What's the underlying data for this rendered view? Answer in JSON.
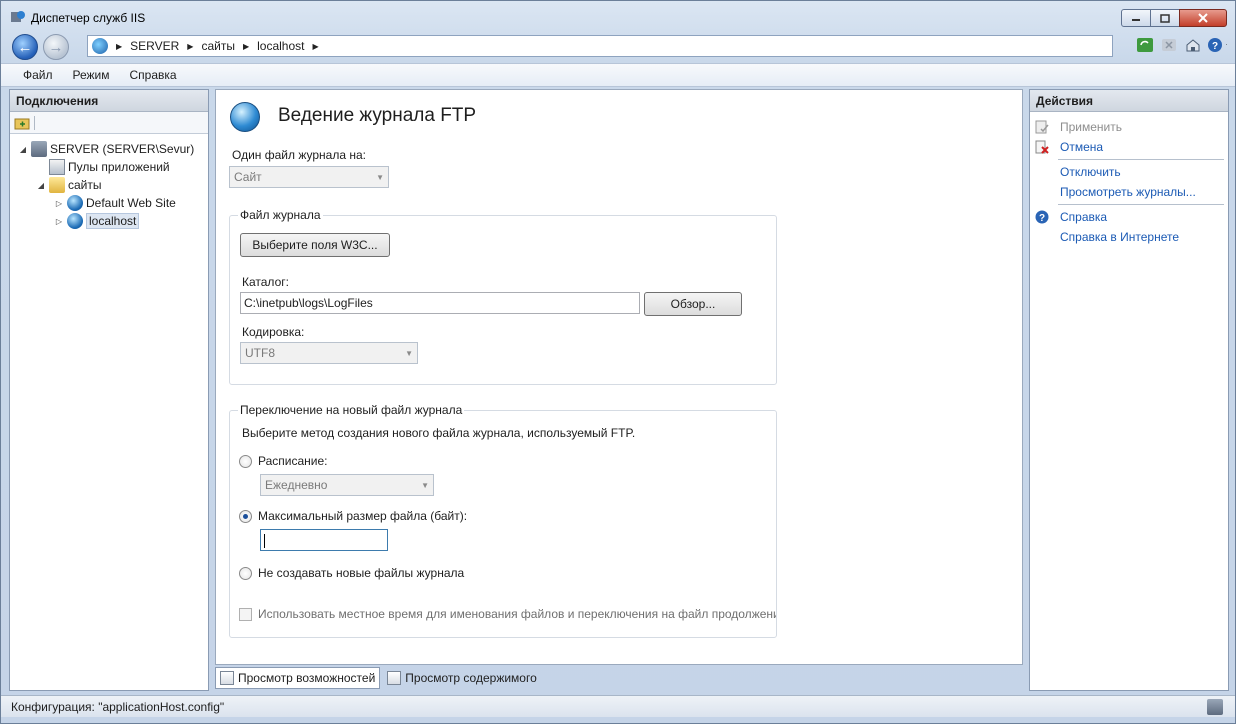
{
  "window": {
    "title": "Диспетчер служб IIS"
  },
  "breadcrumb": [
    "SERVER",
    "сайты",
    "localhost"
  ],
  "menu": [
    "Файл",
    "Режим",
    "Справка"
  ],
  "connections": {
    "header": "Подключения",
    "tree": [
      {
        "label": "SERVER (SERVER\\Sevur)",
        "icon": "server-icon",
        "expander": "◢"
      },
      {
        "label": "Пулы приложений",
        "icon": "app-pools-icon",
        "expander": ""
      },
      {
        "label": "сайты",
        "icon": "sites-folder-icon",
        "expander": "◢"
      },
      {
        "label": "Default Web Site",
        "icon": "globe-icon",
        "expander": "▷"
      },
      {
        "label": "localhost",
        "icon": "globe-icon",
        "expander": "▷"
      }
    ]
  },
  "main": {
    "title": "Ведение журнала FTP",
    "one_log_label": "Один файл журнала на:",
    "one_log_value": "Сайт",
    "log_file_group": "Файл журнала",
    "select_fields_button": "Выберите поля W3C...",
    "directory_label": "Каталог:",
    "directory_value": "C:\\inetpub\\logs\\LogFiles",
    "browse_button": "Обзор...",
    "encoding_label": "Кодировка:",
    "encoding_value": "UTF8",
    "rollover_group": "Переключение на новый файл журнала",
    "rollover_desc": "Выберите метод создания нового файла журнала, используемый FTP.",
    "schedule_label": "Расписание:",
    "schedule_value": "Ежедневно",
    "max_size_label": "Максимальный размер файла (байт):",
    "max_size_value": "",
    "no_new_files_label": "Не создавать новые файлы журнала",
    "local_time_label": "Использовать местное время для именования файлов и переключения на файл продолжени"
  },
  "tabs": {
    "features": "Просмотр возможностей",
    "content": "Просмотр содержимого"
  },
  "actions": {
    "header": "Действия",
    "apply": "Применить",
    "cancel": "Отмена",
    "disable": "Отключить",
    "view_logs": "Просмотреть журналы...",
    "help": "Справка",
    "online_help": "Справка в Интернете"
  },
  "status": {
    "text": "Конфигурация: \"applicationHost.config\""
  }
}
